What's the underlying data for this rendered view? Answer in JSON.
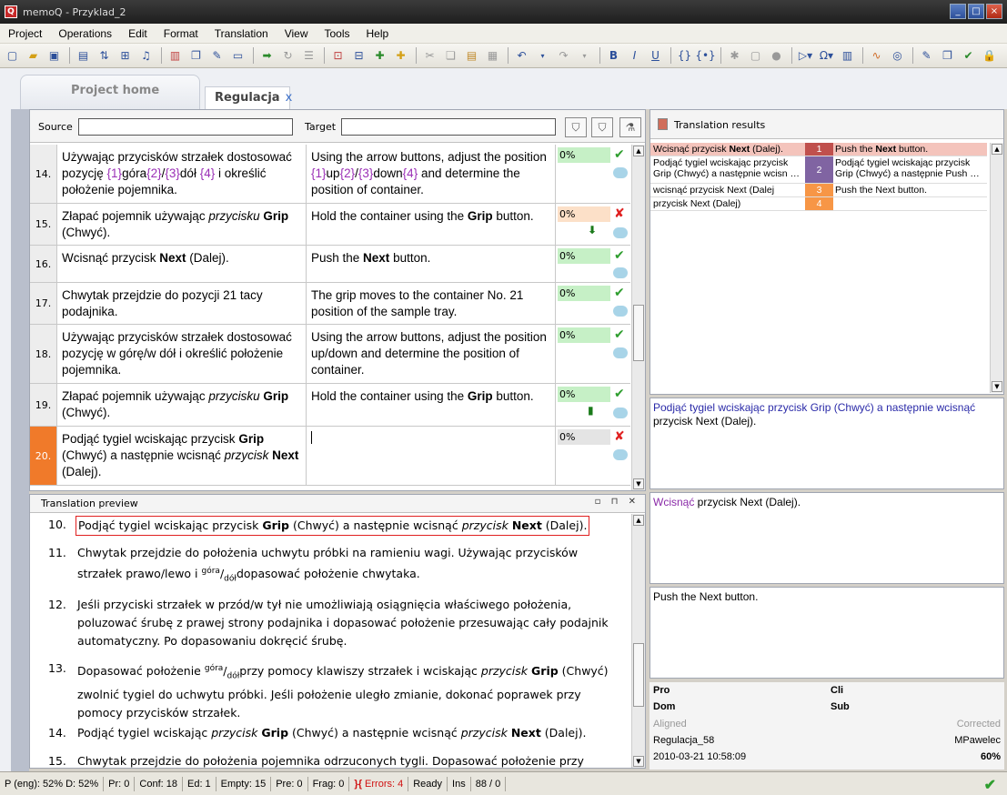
{
  "window": {
    "title": "memoQ - Przyklad_2"
  },
  "menu": [
    "Project",
    "Operations",
    "Edit",
    "Format",
    "Translation",
    "View",
    "Tools",
    "Help"
  ],
  "tabs": {
    "home": "Project home",
    "doc": "Regulacja",
    "doc_close": "x"
  },
  "filter": {
    "source_label": "Source",
    "target_label": "Target",
    "source_value": "",
    "target_value": ""
  },
  "rows": [
    {
      "num": "14.",
      "src": "Używając przycisków strzałek dostosować pozycję {1}góra{2}/{3}dół {4} i określić położenie pojemnika.",
      "tgt": "Using the arrow buttons, adjust the position {1}up{2}/{3}down{4} and determine the position of container.",
      "pct": "0%"
    },
    {
      "num": "15.",
      "src": "Złapać pojemnik używając przycisku Grip (Chwyć).",
      "tgt": "Hold the container using the Grip button.",
      "pct": "0%"
    },
    {
      "num": "16.",
      "src": "Wcisnąć przycisk Next (Dalej).",
      "tgt": "Push the Next button.",
      "pct": "0%"
    },
    {
      "num": "17.",
      "src": "Chwytak przejdzie do pozycji 21 tacy podajnika.",
      "tgt": "The grip moves to the container No. 21 position of the sample tray.",
      "pct": "0%"
    },
    {
      "num": "18.",
      "src": "Używając przycisków strzałek dostosować pozycję w górę/w dół i określić położenie pojemnika.",
      "tgt": "Using the arrow buttons, adjust the position up/down and determine the position of container.",
      "pct": "0%"
    },
    {
      "num": "19.",
      "src": "Złapać pojemnik używając przycisku Grip (Chwyć).",
      "tgt": "Hold the container using the Grip button.",
      "pct": "0%"
    },
    {
      "num": "20.",
      "src": "Podjąć tygiel wciskając przycisk Grip (Chwyć) a następnie wcisnąć przycisk Next (Dalej).",
      "tgt": "",
      "pct": "0%"
    }
  ],
  "preview": {
    "title": "Translation preview",
    "items": [
      {
        "n": "10.",
        "text": "Podjąć tygiel wciskając przycisk Grip (Chwyć) a następnie wcisnąć przycisk Next (Dalej)."
      },
      {
        "n": "11.",
        "text": "Chwytak przejdzie do położenia uchwytu próbki na ramieniu wagi. Używając przycisków strzałek prawo/lewo i góra/dół dopasować położenie chwytaka."
      },
      {
        "n": "12.",
        "text": "Jeśli przyciski strzałek w przód/w tył nie umożliwiają osiągnięcia właściwego położenia, poluzować śrubę z prawej strony podajnika i dopasować położenie przesuwając cały podajnik automatyczny. Po dopasowaniu dokręcić śrubę."
      },
      {
        "n": "13.",
        "text": "Dopasować położenie góra/dół przy pomocy klawiszy strzałek i wciskając przycisk Grip (Chwyć) zwolnić tygiel do uchwytu próbki. Jeśli położenie uległo zmianie, dokonać poprawek przy pomocy przycisków strzałek."
      },
      {
        "n": "14.",
        "text": "Podjąć tygiel wciskając przycisk Grip (Chwyć) a następnie wcisnąć przycisk Next (Dalej)."
      },
      {
        "n": "15.",
        "text": "Chwytak przejdzie do położenia pojemnika odrzuconych tygli. Dopasować położenie przy"
      }
    ]
  },
  "translation_results": {
    "title": "Translation results",
    "rows": [
      {
        "src": "Wcisnąć przycisk Next (Dalej).",
        "key": "1",
        "tgt": "Push the Next button.",
        "color": "#c0504d"
      },
      {
        "src": "Podjąć tygiel wciskając przycisk Grip (Chwyć) a następnie wcisn …",
        "key": "2",
        "tgt": "Podjąć tygiel wciskając przycisk Grip (Chwyć) a następnie Push …",
        "color": "#8064a2"
      },
      {
        "src": "wcisnąć przycisk Next (Dalej",
        "key": "3",
        "tgt": "Push the Next button.",
        "color": "#f79646"
      },
      {
        "src": "przycisk Next (Dalej)",
        "key": "4",
        "tgt": "",
        "color": "#f79646"
      }
    ]
  },
  "compare": {
    "box1": "Podjąć tygiel wciskając przycisk Grip (Chwyć) a następnie wcisnąć przycisk Next (Dalej).",
    "box2": "Wcisnąć przycisk Next (Dalej).",
    "box3": "Push the Next button."
  },
  "meta": {
    "pro": "Pro",
    "cli": "Cli",
    "dom": "Dom",
    "sub": "Sub",
    "aligned": "Aligned",
    "corrected": "Corrected",
    "doc": "Regulacja_58",
    "user": "MPawelec",
    "date": "2010-03-21 10:58:09",
    "pct": "60%"
  },
  "status": {
    "p": "P (eng): 52%",
    "d": "D: 52%",
    "pr": "Pr: 0",
    "conf": "Conf: 18",
    "ed": "Ed: 1",
    "empty": "Empty: 15",
    "pre": "Pre: 0",
    "frag": "Frag: 0",
    "errors": "Errors: 4",
    "ready": "Ready",
    "ins": "Ins",
    "pos": "88 / 0"
  },
  "colors": {
    "active_row": "#f07a2a",
    "tag": "#9b30b6",
    "match_100": "#c6f0c6"
  }
}
